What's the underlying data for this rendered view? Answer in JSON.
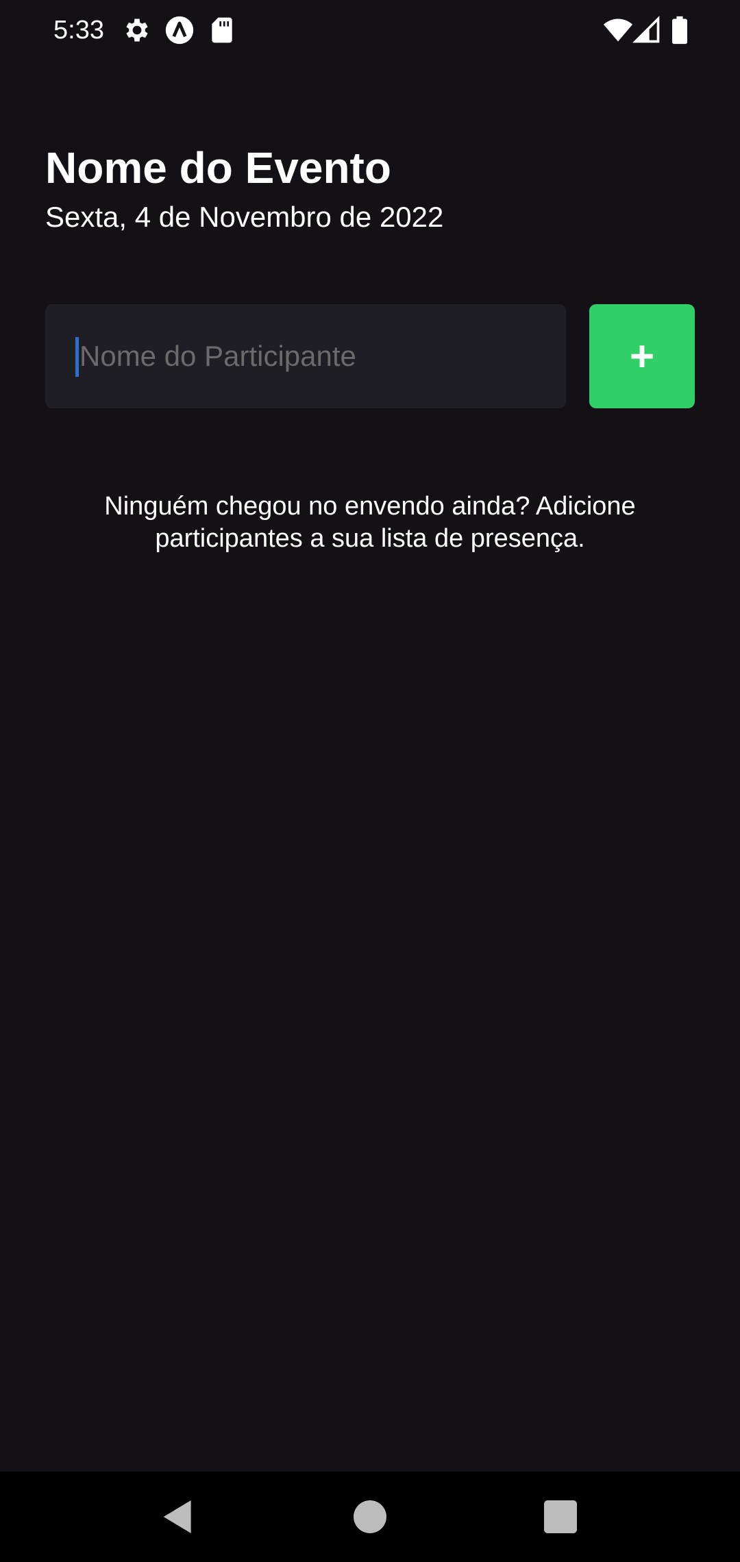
{
  "status_bar": {
    "time": "5:33",
    "icons": [
      "settings-gear-icon",
      "app-notification-icon",
      "sd-card-icon",
      "wifi-icon",
      "cell-signal-icon",
      "battery-icon"
    ]
  },
  "header": {
    "title": "Nome do Evento",
    "date": "Sexta, 4 de Novembro de 2022"
  },
  "form": {
    "input_value": "",
    "input_placeholder": "Nome do Participante",
    "add_button_label": "+"
  },
  "participants": {
    "empty_message": "Ninguém chegou no envendo ainda? Adicione participantes a sua lista de presença."
  },
  "colors": {
    "background": "#131016",
    "input_background": "#1f1e25",
    "accent_green": "#31cf67",
    "placeholder": "#6b6b6b",
    "cursor": "#2f6fd0"
  },
  "navigation": {
    "buttons": [
      "back-icon",
      "home-icon",
      "recents-icon"
    ]
  }
}
